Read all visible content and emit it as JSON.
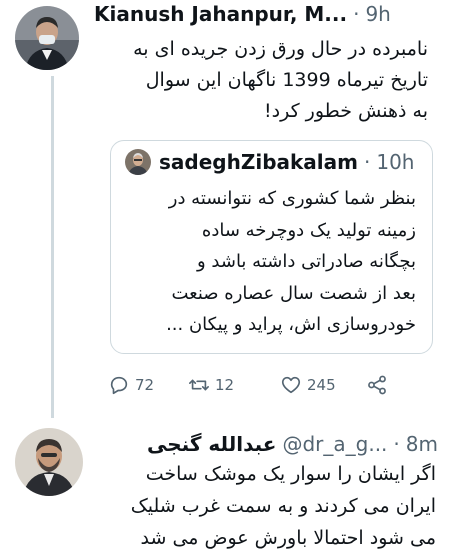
{
  "tweet1": {
    "author_name": "Kianush Jahanpur, M...",
    "separator": "·",
    "time": "9h",
    "text_lines": [
      "نامبرده در حال ورق زدن جریده ای به",
      "تاریخ تیرماه 1399 ناگهان این سوال",
      "به ذهنش خطور کرد!"
    ],
    "quote": {
      "author_handle": "sadeghZibakalam",
      "separator": "·",
      "time": "10h",
      "text_lines": [
        "بنظر شما کشوری که نتوانسته در",
        "زمینه تولید یک دوچرخه ساده",
        "بچگانه صادراتی داشته باشد و",
        "بعد از شصت سال عصاره صنعت",
        "خودروسازی اش، پراید و پیکان ..."
      ]
    },
    "actions": {
      "replies": "72",
      "retweets": "12",
      "likes": "245"
    }
  },
  "tweet2": {
    "author_name": "عبدالله گنجی",
    "author_handle": "@dr_a_g...",
    "separator": "·",
    "time": "8m",
    "text_lines": [
      "اگر ایشان را سوار یک موشک ساخت",
      "ایران می کردند و به سمت غرب شلیک",
      "می شود احتمالا باورش عوض می شد"
    ]
  },
  "icons": {
    "reply": "reply-icon",
    "retweet": "retweet-icon",
    "like": "heart-icon",
    "share": "share-icon"
  },
  "colors": {
    "text": "#0f1419",
    "secondary": "#536471",
    "border": "#cfd9de"
  }
}
